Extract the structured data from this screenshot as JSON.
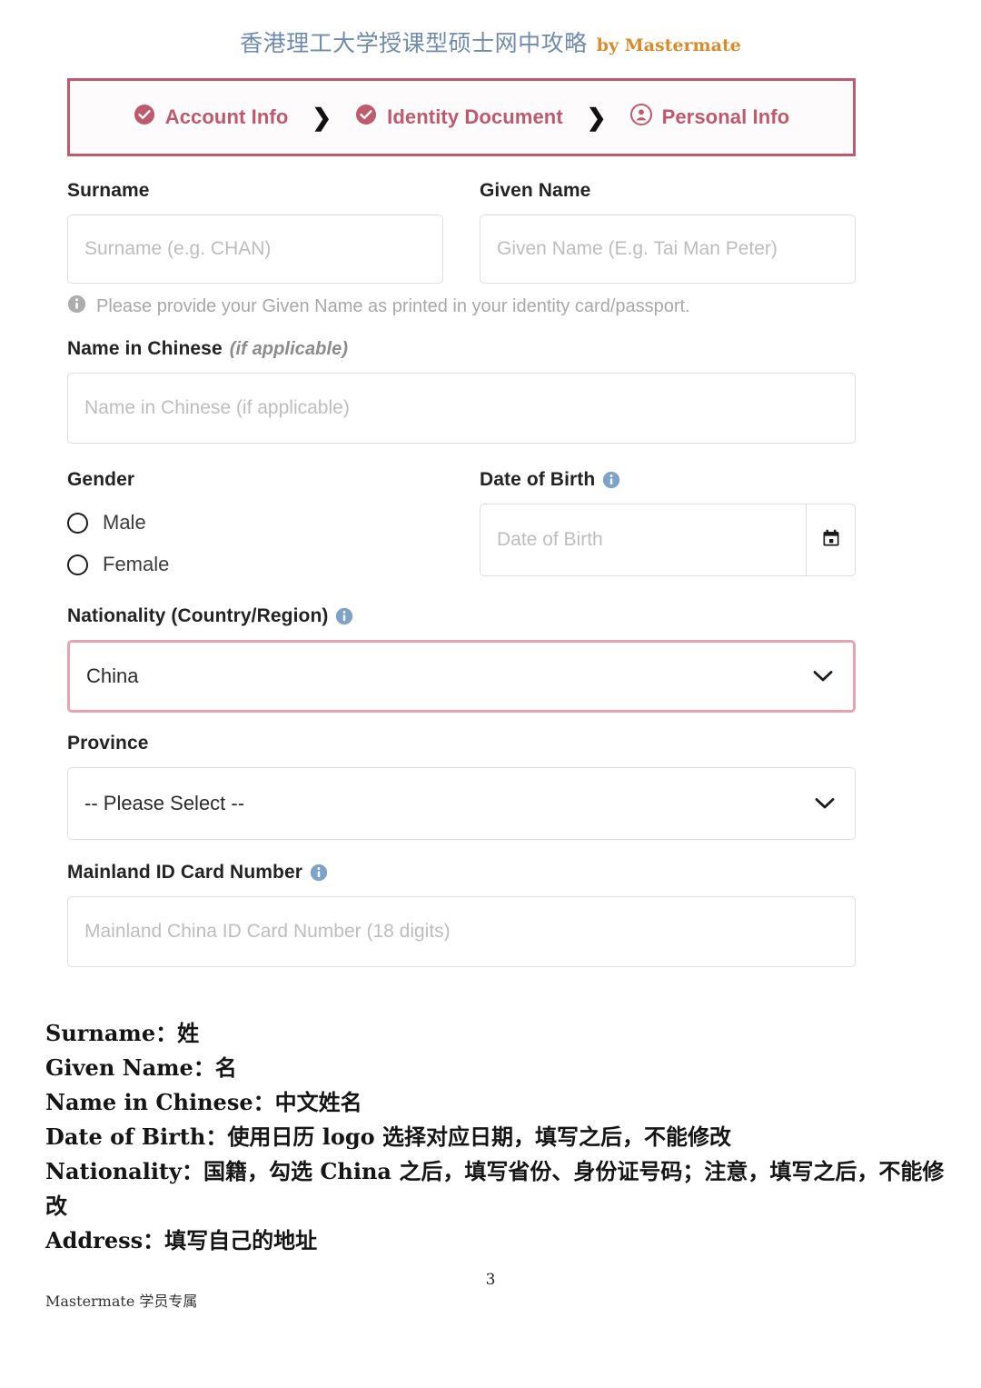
{
  "document": {
    "header_cn": "香港理工大学授课型硕士网中攻略",
    "header_en": "by Mastermate",
    "header_cn_color": "#6f8bad",
    "header_en_color": "#d98a2b",
    "page_number": "3",
    "footer_note": "Mastermate 学员专属"
  },
  "stepper": {
    "border_color": "#bd5a6d",
    "accent_color": "#bd5a6d",
    "separator": "❯",
    "steps": [
      {
        "label": "Account Info",
        "icon": "check-circle-icon",
        "state": "completed"
      },
      {
        "label": "Identity Document",
        "icon": "check-circle-icon",
        "state": "completed"
      },
      {
        "label": "Personal Info",
        "icon": "person-circle-icon",
        "state": "current"
      }
    ]
  },
  "form": {
    "surname": {
      "label": "Surname",
      "value": "",
      "placeholder": "Surname (e.g. CHAN)"
    },
    "given_name": {
      "label": "Given Name",
      "value": "",
      "placeholder": "Given Name (E.g. Tai Man Peter)",
      "hint": "Please provide your Given Name as printed in your identity card/passport.",
      "hint_icon": "info-circle-icon"
    },
    "name_in_chinese": {
      "label": "Name in Chinese",
      "label_suffix": "(if applicable)",
      "value": "",
      "placeholder": "Name in Chinese (if applicable)"
    },
    "gender": {
      "label": "Gender",
      "selected": "",
      "options": [
        {
          "label": "Male",
          "checked": false
        },
        {
          "label": "Female",
          "checked": false
        }
      ]
    },
    "date_of_birth": {
      "label": "Date of Birth",
      "info_icon": "info-circle-icon",
      "info_icon_color": "#7fa3c6",
      "value": "",
      "placeholder": "Date of Birth",
      "button_icon": "calendar-icon"
    },
    "nationality": {
      "label": "Nationality (Country/Region)",
      "info_icon": "info-circle-icon",
      "info_icon_color": "#7fa3c6",
      "value": "China",
      "chevron": "⌄",
      "focused": true,
      "focus_border_color": "#e8a3b2"
    },
    "province": {
      "label": "Province",
      "value": "-- Please Select --",
      "chevron": "⌄",
      "focused": false
    },
    "mainland_id": {
      "label": "Mainland ID Card Number",
      "info_icon": "info-circle-icon",
      "info_icon_color": "#7fa3c6",
      "value": "",
      "placeholder": "Mainland China ID Card Number (18 digits)"
    }
  },
  "annotations": [
    "Surname：姓",
    "Given Name：名",
    "Name in Chinese：中文姓名",
    "Date of Birth：使用日历 logo 选择对应日期，填写之后，不能修改",
    "Nationality：国籍，勾选 China 之后，填写省份、身份证号码；注意，填写之后，不能修改",
    "Address：填写自己的地址"
  ]
}
